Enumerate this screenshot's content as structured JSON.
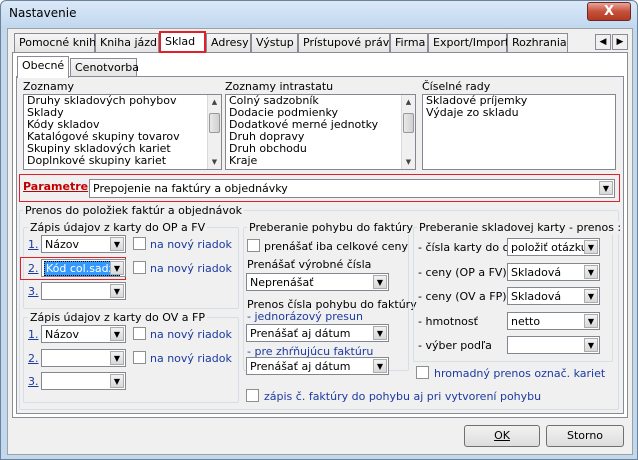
{
  "window": {
    "title": "Nastavenie",
    "close_glyph": "X"
  },
  "tabs": [
    "Pomocné knihy",
    "Kniha jázd",
    "Sklad",
    "Adresy",
    "Výstup",
    "Prístupové práva",
    "Firma",
    "Export/Import",
    "Rozhrania"
  ],
  "subtabs": [
    "Obecné",
    "Cenotvorba"
  ],
  "lists": {
    "zoznamy_label": "Zoznamy",
    "zoznamy": [
      "Druhy skladových pohybov",
      "Sklady",
      "Kódy skladov",
      "Katalógové skupiny tovarov",
      "Skupiny skladových kariet",
      "Doplnkové skupiny kariet"
    ],
    "intrastat_label": "Zoznamy intrastatu",
    "intrastat": [
      "Colný sadzobník",
      "Dodacie podmienky",
      "Dodatkové merné jednotky",
      "Druh dopravy",
      "Druh obchodu",
      "Kraje"
    ],
    "ciselne_label": "Číselné rady",
    "ciselne": [
      "Skladové príjemky",
      "Výdaje zo skladu"
    ]
  },
  "parametre": {
    "label": "Parametre",
    "value": "Prepojenie na faktúry a objednávky"
  },
  "prenos": {
    "title": "Prenos do položiek faktúr a objednávok",
    "op_fv": {
      "title": "Zápis údajov z karty do OP a FV",
      "rows": [
        {
          "num": "1.",
          "value": "Názov",
          "new_row": "na nový riadok"
        },
        {
          "num": "2.",
          "value": "Kód col.sadz.",
          "new_row": "na nový riadok"
        },
        {
          "num": "3.",
          "value": ""
        }
      ]
    },
    "ov_fp": {
      "title": "Zápis údajov z karty do OV a FP",
      "rows": [
        {
          "num": "1.",
          "value": "Názov",
          "new_row": "na nový riadok"
        },
        {
          "num": "2.",
          "value": "",
          "new_row": "na nový riadok"
        },
        {
          "num": "3.",
          "value": ""
        }
      ]
    }
  },
  "pohyb": {
    "title": "Preberanie pohybu do faktúry",
    "only_total": "prenášať iba celkové ceny",
    "vyrobne_label": "Prenášať výrobné čísla",
    "vyrobne_value": "Neprenášať",
    "prenos_label": "Prenos čísla pohybu do faktúry",
    "jednorazovy_label": "- jednorázový presun",
    "jednorazovy_value": "Prenášať aj dátum",
    "zhrnujuci_label": "- pre zhŕňujúcu faktúru",
    "zhrnujuci_value": "Prenášať aj dátum"
  },
  "karta": {
    "title": "Preberanie skladovej karty - prenos :",
    "rows": [
      {
        "label": "- čísla karty do obj.",
        "value": "položiť otázku"
      },
      {
        "label": "- ceny (OP a FV)",
        "value": "Skladová"
      },
      {
        "label": "- ceny (OV a FP)",
        "value": "Skladová"
      },
      {
        "label": "- hmotnosť",
        "value": "netto"
      },
      {
        "label": "- výber podľa",
        "value": ""
      }
    ],
    "hromadny": "hromadný prenos označ. kariet"
  },
  "zapis_faktury": "zápis č. faktúry do pohybu aj pri vytvorení pohybu",
  "buttons": {
    "ok": "OK",
    "cancel": "Storno"
  },
  "accent": "#e0202a"
}
